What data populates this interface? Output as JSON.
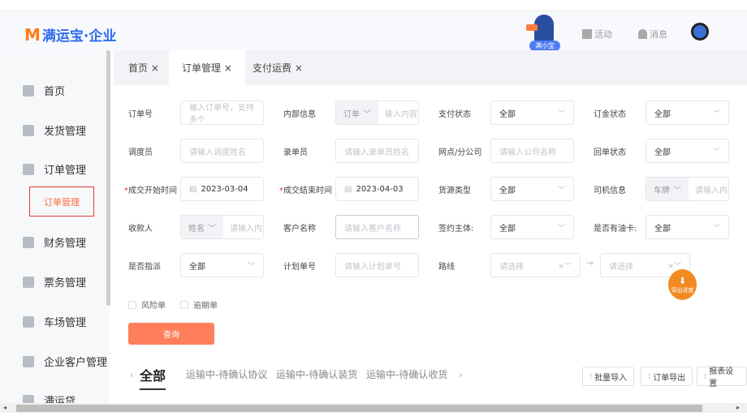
{
  "header": {
    "logo_text": "满运宝·企业",
    "mascot_label": "满小宝",
    "activity": "活动",
    "messages": "消息"
  },
  "sidebar": {
    "items": [
      {
        "label": "首页"
      },
      {
        "label": "发货管理"
      },
      {
        "label": "订单管理"
      },
      {
        "label": "财务管理"
      },
      {
        "label": "票务管理"
      },
      {
        "label": "车场管理"
      },
      {
        "label": "企业客户管理"
      },
      {
        "label": "满运贷"
      }
    ],
    "active_sub": "订单管理"
  },
  "tabs": [
    {
      "label": "首页 ×"
    },
    {
      "label": "订单管理 ×"
    },
    {
      "label": "支付运费 ×"
    }
  ],
  "form": {
    "order_no": {
      "label": "订单号",
      "placeholder": "输入订单号，支持多个"
    },
    "internal": {
      "label": "内部信息",
      "prefix": "订单",
      "placeholder": "输入内容"
    },
    "pay_status": {
      "label": "支付状态",
      "value": "全部"
    },
    "deposit_status": {
      "label": "订金状态",
      "value": "全部"
    },
    "dispatcher": {
      "label": "调度员",
      "placeholder": "请输入调度姓名"
    },
    "recorder": {
      "label": "录单员",
      "placeholder": "请输入录单员姓名"
    },
    "branch": {
      "label": "网点/分公司",
      "placeholder": "请输入公司名称"
    },
    "receipt_status": {
      "label": "回单状态",
      "value": "全部"
    },
    "start_time": {
      "label": "成交开始时间",
      "value": "2023-03-04"
    },
    "end_time": {
      "label": "成交结束时间",
      "value": "2023-04-03"
    },
    "cargo_type": {
      "label": "货源类型",
      "value": "全部"
    },
    "driver": {
      "label": "司机信息",
      "prefix": "车牌",
      "placeholder": "请输入内容"
    },
    "payee": {
      "label": "收款人",
      "prefix": "姓名",
      "placeholder": "请输入内容"
    },
    "customer": {
      "label": "客户名称",
      "placeholder": "请输入客户名称"
    },
    "sign_entity": {
      "label": "签约主体:",
      "value": "全部"
    },
    "oil_card": {
      "label": "是否有油卡:",
      "value": "全部"
    },
    "assigned": {
      "label": "是否指派",
      "value": "全部"
    },
    "plan_no": {
      "label": "计划单号",
      "placeholder": "请输入计划单号"
    },
    "route": {
      "label": "路线",
      "from_placeholder": "请选择",
      "to_placeholder": "请选择"
    },
    "risk": "风险单",
    "overdue": "逾期单",
    "query": "查询"
  },
  "export_progress": "导出进度",
  "status_tabs": [
    "全部",
    "运输中-待确认协议",
    "运输中-待确认装货",
    "运输中-待确认收货"
  ],
  "actions": {
    "import": "批量导入",
    "export": "订单导出",
    "report": "报表设置"
  }
}
